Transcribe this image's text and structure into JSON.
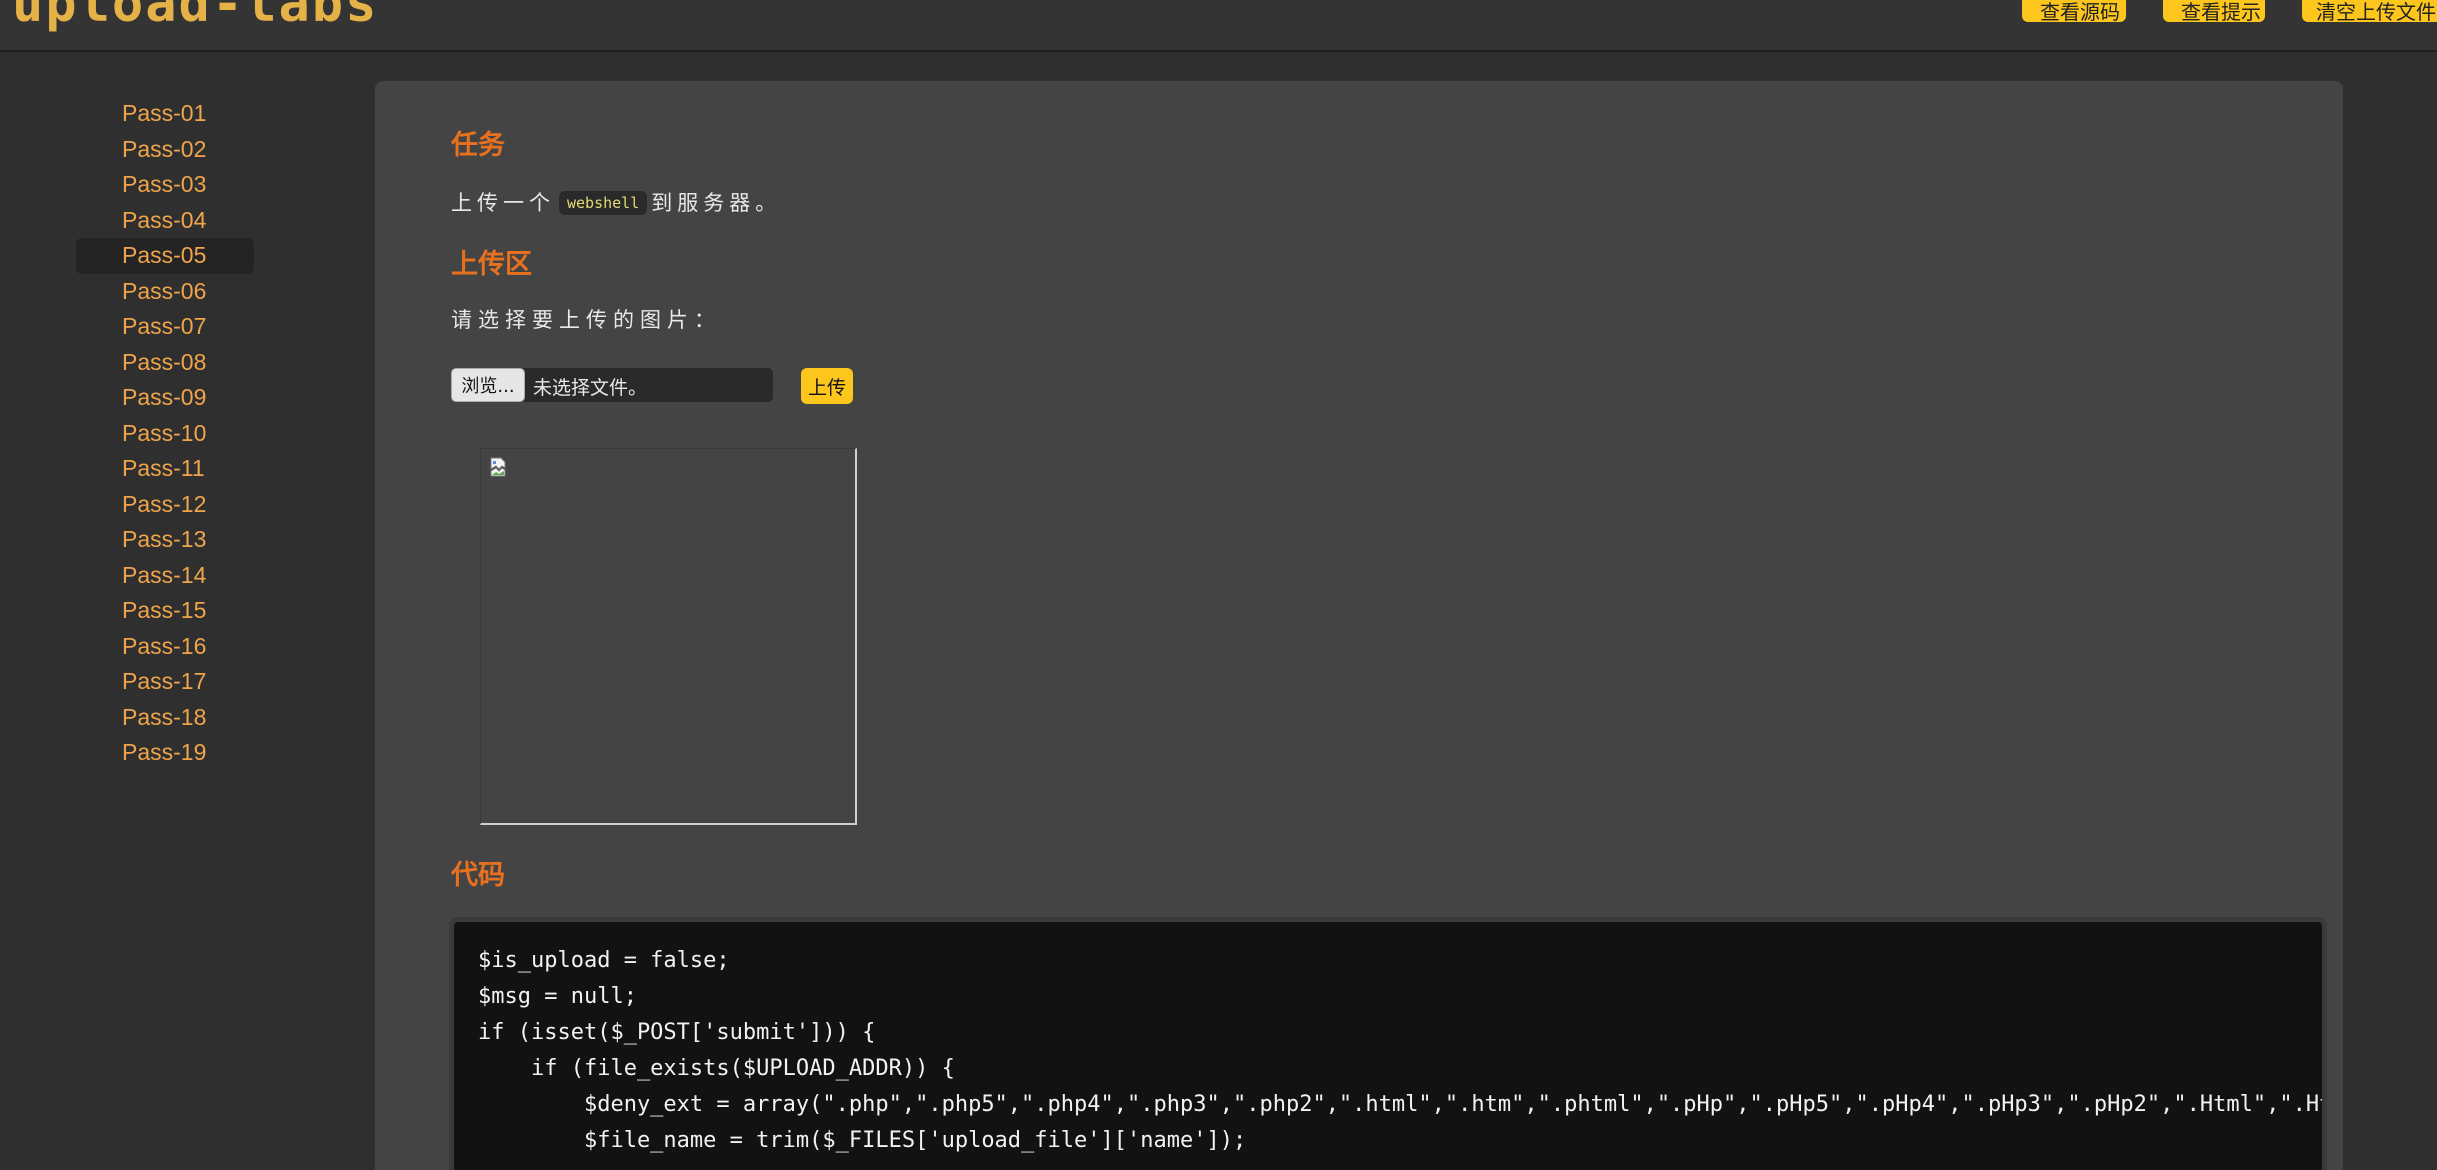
{
  "header": {
    "logo_text": "upload-labs",
    "buttons": [
      "查看源码",
      "查看提示",
      "清空上传文件"
    ]
  },
  "sidebar": {
    "items": [
      "Pass-01",
      "Pass-02",
      "Pass-03",
      "Pass-04",
      "Pass-05",
      "Pass-06",
      "Pass-07",
      "Pass-08",
      "Pass-09",
      "Pass-10",
      "Pass-11",
      "Pass-12",
      "Pass-13",
      "Pass-14",
      "Pass-15",
      "Pass-16",
      "Pass-17",
      "Pass-18",
      "Pass-19"
    ],
    "active_item": "Pass-05"
  },
  "task": {
    "title": "任务",
    "text_before": "上传一个",
    "code": "webshell",
    "text_after": "到服务器。"
  },
  "upload": {
    "title": "上传区",
    "prompt": "请选择要上传的图片：",
    "browse_label": "浏览...",
    "file_status": "未选择文件。",
    "submit_label": "上传"
  },
  "code": {
    "title": "代码",
    "lines": [
      "$is_upload = false;",
      "$msg = null;",
      "if (isset($_POST['submit'])) {",
      "    if (file_exists($UPLOAD_ADDR)) {",
      "        $deny_ext = array(\".php\",\".php5\",\".php4\",\".php3\",\".php2\",\".html\",\".htm\",\".phtml\",\".pHp\",\".pHp5\",\".pHp4\",\".pHp3\",\".pHp2\",\".Html\",\".Htm\"",
      "        $file_name = trim($_FILES['upload_file']['name']);"
    ]
  },
  "colors": {
    "accent_orange": "#e8711f",
    "link_orange": "#f0a44b",
    "button_yellow": "#fcc61d"
  }
}
